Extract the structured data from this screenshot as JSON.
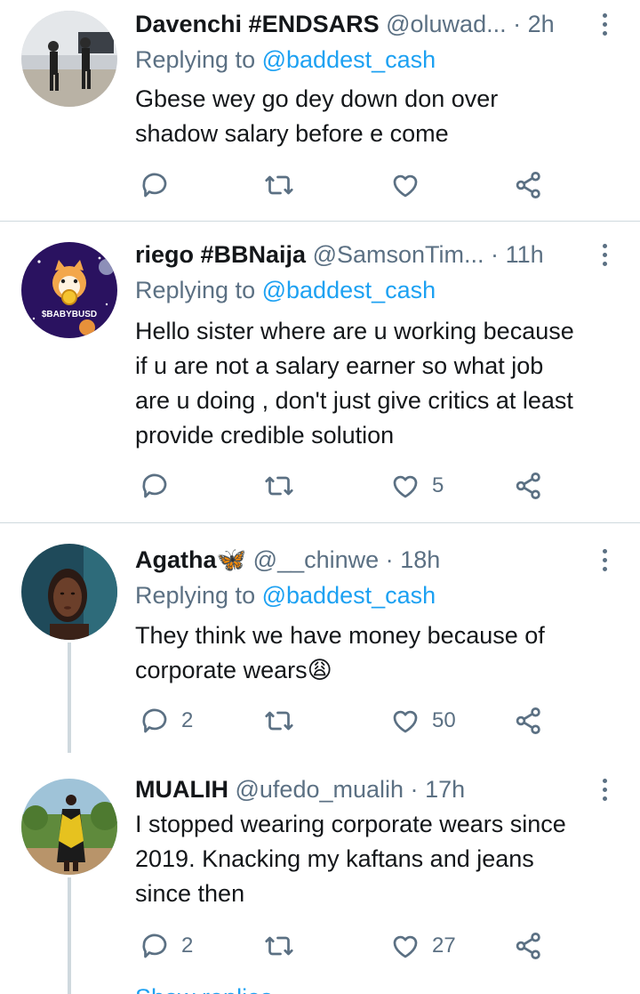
{
  "tweets": [
    {
      "display_name": "Davenchi #ENDSARS",
      "handle": "@oluwad...",
      "separator": "·",
      "time": "2h",
      "replying_prefix": "Replying to",
      "replying_to": "@baddest_cash",
      "body_lines": [
        "Gbese wey go dey down don over",
        "shadow salary before e come"
      ],
      "reply_count": "",
      "retweet_count": "",
      "like_count": ""
    },
    {
      "display_name": "riego #BBNaija",
      "handle": "@SamsonTim...",
      "separator": "·",
      "time": "11h",
      "replying_prefix": "Replying to",
      "replying_to": "@baddest_cash",
      "avatar_text": "$BABYBUSD",
      "body_lines": [
        "Hello sister where are u working because",
        "if u are not a salary earner so what job",
        "are u doing , don't just give critics at least",
        "provide credible solution"
      ],
      "reply_count": "",
      "retweet_count": "",
      "like_count": "5"
    },
    {
      "display_name": "Agatha🦋",
      "handle": "@__chinwe",
      "separator": "·",
      "time": "18h",
      "replying_prefix": "Replying to",
      "replying_to": "@baddest_cash",
      "body_lines": [
        "They think we have money because of",
        "corporate wears😩"
      ],
      "reply_count": "2",
      "retweet_count": "",
      "like_count": "50"
    },
    {
      "display_name": "MUALIH",
      "handle": "@ufedo_mualih",
      "separator": "·",
      "time": "17h",
      "body_lines": [
        "I stopped wearing corporate wears since",
        "2019. Knacking my kaftans and jeans",
        "since then"
      ],
      "reply_count": "2",
      "retweet_count": "",
      "like_count": "27"
    }
  ],
  "show_replies": "Show replies",
  "colors": {
    "accent": "#1da1f2",
    "secondary_text": "#5b7083",
    "divider": "#cfd9de",
    "text": "#14171a"
  },
  "icons": [
    "reply-icon",
    "retweet-icon",
    "like-icon",
    "share-icon",
    "more-options-icon"
  ]
}
